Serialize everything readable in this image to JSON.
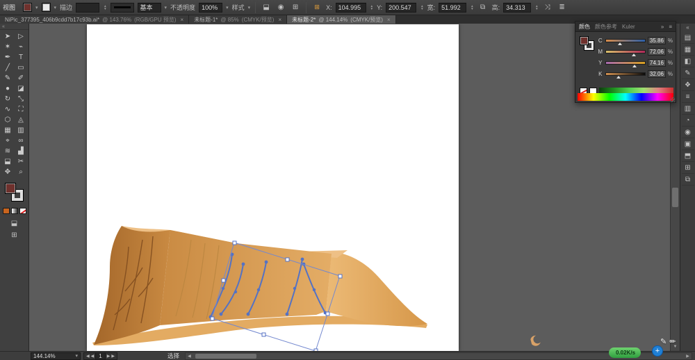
{
  "app": {
    "menu_label": "视图"
  },
  "icons": {
    "dropdown": "▾",
    "spinner_up": "▲",
    "spinner_down": "▼",
    "chain": "⧉",
    "transform": "⤨",
    "menu": "≣",
    "doc": "⬓",
    "target": "◉",
    "grid": "⊞",
    "locator": "⊞",
    "chevrons": "»",
    "collapse": "«",
    "panel_menu": "≡",
    "close": "×",
    "left": "◀",
    "right": "▶",
    "up": "▲",
    "down": "▼",
    "plus": "+",
    "pen": "✎",
    "pencil": "✏"
  },
  "control_bar": {
    "stroke_label": "描边",
    "stroke_value": "",
    "brush_style": "基本",
    "opacity_label": "不透明度",
    "opacity_value": "100%",
    "style_label": "样式",
    "x_label": "X:",
    "x_value": "104.995",
    "y_label": "Y:",
    "y_value": "200.547",
    "w_label": "宽:",
    "w_value": "51.992",
    "h_label": "高:",
    "h_value": "34.313"
  },
  "tabs": [
    {
      "title": "NiPic_377395_406b9cdd7b17c93b.ai*",
      "zoom": "@ 143.76%",
      "mode": "(RGB/GPU 预览)",
      "active": false
    },
    {
      "title": "未标题-1*",
      "zoom": "@ 85%",
      "mode": "(CMYK/预览)",
      "active": false
    },
    {
      "title": "未标题-2*",
      "zoom": "@ 144.14%",
      "mode": "(CMYK/预览)",
      "active": true
    }
  ],
  "toolbar": {
    "tools": [
      {
        "name": "selection-tool",
        "glyph": "➤"
      },
      {
        "name": "direct-selection-tool",
        "glyph": "▷"
      },
      {
        "name": "magic-wand-tool",
        "glyph": "✶"
      },
      {
        "name": "lasso-tool",
        "glyph": "⌁"
      },
      {
        "name": "pen-tool",
        "glyph": "✒"
      },
      {
        "name": "type-tool",
        "glyph": "T"
      },
      {
        "name": "line-segment-tool",
        "glyph": "╱"
      },
      {
        "name": "rectangle-tool",
        "glyph": "▭"
      },
      {
        "name": "paintbrush-tool",
        "glyph": "✎"
      },
      {
        "name": "pencil-tool",
        "glyph": "✐"
      },
      {
        "name": "blob-brush-tool",
        "glyph": "●"
      },
      {
        "name": "eraser-tool",
        "glyph": "◪"
      },
      {
        "name": "rotate-tool",
        "glyph": "↻"
      },
      {
        "name": "scale-tool",
        "glyph": "⤡"
      },
      {
        "name": "width-tool",
        "glyph": "∿"
      },
      {
        "name": "free-transform-tool",
        "glyph": "⛶"
      },
      {
        "name": "shape-builder-tool",
        "glyph": "⬡"
      },
      {
        "name": "perspective-grid-tool",
        "glyph": "◬"
      },
      {
        "name": "mesh-tool",
        "glyph": "▦"
      },
      {
        "name": "gradient-tool",
        "glyph": "▥"
      },
      {
        "name": "eyedropper-tool",
        "glyph": "⌖"
      },
      {
        "name": "blend-tool",
        "glyph": "∞"
      },
      {
        "name": "symbol-sprayer-tool",
        "glyph": "≋"
      },
      {
        "name": "column-graph-tool",
        "glyph": "▟"
      },
      {
        "name": "artboard-tool",
        "glyph": "⬓"
      },
      {
        "name": "slice-tool",
        "glyph": "✂"
      },
      {
        "name": "hand-tool",
        "glyph": "✥"
      },
      {
        "name": "zoom-tool",
        "glyph": "⌕"
      }
    ]
  },
  "color_panel": {
    "tabs": [
      "颜色",
      "颜色参考",
      "Kuler"
    ],
    "sliders": [
      {
        "channel": "C",
        "value": "35.86",
        "unit": "%",
        "percent": 36
      },
      {
        "channel": "M",
        "value": "72.06",
        "unit": "%",
        "percent": 72
      },
      {
        "channel": "Y",
        "value": "74.16",
        "unit": "%",
        "percent": 74
      },
      {
        "channel": "K",
        "value": "32.06",
        "unit": "%",
        "percent": 32
      }
    ],
    "fill_color": "#6f312d"
  },
  "dock": {
    "icons": [
      {
        "name": "color-panel-icon",
        "glyph": "▤"
      },
      {
        "name": "color-guide-panel-icon",
        "glyph": "▦"
      },
      {
        "name": "swatches-panel-icon",
        "glyph": "◧"
      },
      {
        "name": "brushes-panel-icon",
        "glyph": "✎"
      },
      {
        "name": "symbols-panel-icon",
        "glyph": "❖"
      },
      {
        "name": "stroke-panel-icon",
        "glyph": "≡"
      },
      {
        "name": "gradient-panel-icon",
        "glyph": "▥"
      },
      {
        "name": "transparency-panel-icon",
        "glyph": "◔"
      },
      {
        "name": "appearance-panel-icon",
        "glyph": "◉"
      },
      {
        "name": "graphic-styles-panel-icon",
        "glyph": "▣"
      },
      {
        "name": "layers-panel-icon",
        "glyph": "⬒"
      },
      {
        "name": "artboards-panel-icon",
        "glyph": "⊞"
      },
      {
        "name": "links-panel-icon",
        "glyph": "⧉"
      }
    ]
  },
  "status_bar": {
    "zoom_value": "144.14%",
    "artboard_label": "1",
    "tool_status": "选择",
    "net_speed": "0.02K/s"
  }
}
